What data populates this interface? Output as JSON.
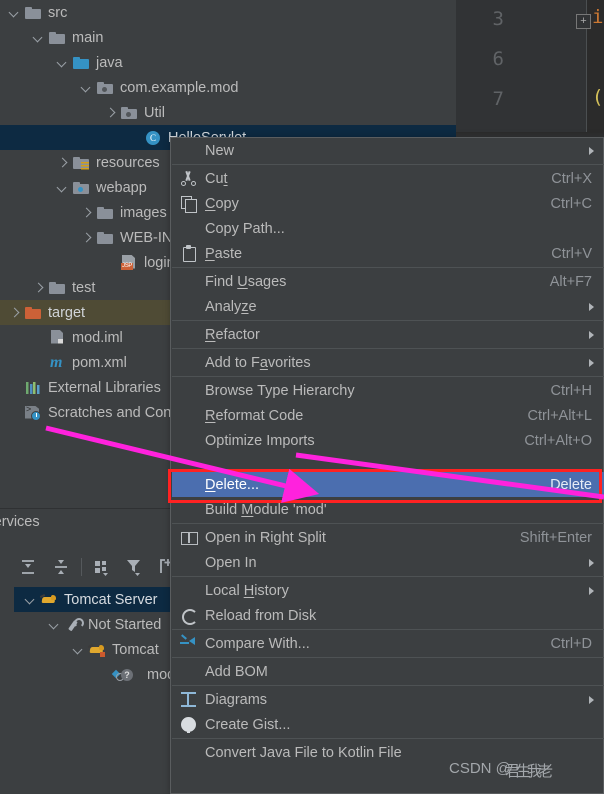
{
  "app": {
    "theme_bg": "#3c3f41",
    "selection_blue": "#0d2a42",
    "menu_highlight": "#4b6eaf",
    "annotation_red": "#ff2222",
    "annotation_magenta": "#ff22dd"
  },
  "editor": {
    "line_numbers": [
      "3",
      "6",
      "7"
    ],
    "fold_marker": "+",
    "code_fragments": [
      "i",
      "("
    ]
  },
  "project_tree": {
    "items": [
      {
        "label": "src",
        "indent": 0,
        "arrow": "down",
        "icon": "folder-icon",
        "selected": "none"
      },
      {
        "label": "main",
        "indent": 1,
        "arrow": "down",
        "icon": "folder-icon",
        "selected": "none"
      },
      {
        "label": "java",
        "indent": 2,
        "arrow": "down",
        "icon": "folder-source-icon",
        "selected": "none"
      },
      {
        "label": "com.example.mod",
        "indent": 3,
        "arrow": "down",
        "icon": "package-icon",
        "selected": "none"
      },
      {
        "label": "Util",
        "indent": 4,
        "arrow": "right",
        "icon": "package-icon",
        "selected": "none"
      },
      {
        "label": "HelloServlet",
        "indent": 5,
        "arrow": "none",
        "icon": "java-class-icon",
        "selected": "primary"
      },
      {
        "label": "resources",
        "indent": 2,
        "arrow": "right",
        "icon": "folder-resources-icon",
        "selected": "none"
      },
      {
        "label": "webapp",
        "indent": 2,
        "arrow": "down",
        "icon": "folder-web-icon",
        "selected": "none"
      },
      {
        "label": "images",
        "indent": 3,
        "arrow": "right",
        "icon": "folder-icon",
        "selected": "none"
      },
      {
        "label": "WEB-INF",
        "indent": 3,
        "arrow": "right",
        "icon": "folder-icon",
        "selected": "none"
      },
      {
        "label": "login.jsp",
        "indent": 4,
        "arrow": "none",
        "icon": "jsp-file-icon",
        "selected": "none"
      },
      {
        "label": "test",
        "indent": 1,
        "arrow": "right",
        "icon": "folder-icon",
        "selected": "none"
      },
      {
        "label": "target",
        "indent": 0,
        "arrow": "right",
        "icon": "folder-excluded-icon",
        "selected": "secondary"
      },
      {
        "label": "mod.iml",
        "indent": 1,
        "arrow": "none",
        "icon": "iml-file-icon",
        "selected": "none"
      },
      {
        "label": "pom.xml",
        "indent": 1,
        "arrow": "none",
        "icon": "maven-file-icon",
        "selected": "none"
      },
      {
        "label": "External Libraries",
        "indent": 0,
        "arrow": "none",
        "icon": "libraries-icon",
        "selected": "none"
      },
      {
        "label": "Scratches and Consoles",
        "indent": 0,
        "arrow": "none",
        "icon": "scratches-icon",
        "selected": "none"
      }
    ]
  },
  "services": {
    "title": "Services",
    "toolbar": [
      {
        "name": "expand-all-icon"
      },
      {
        "name": "collapse-all-icon"
      },
      {
        "name": "group-by-icon"
      },
      {
        "name": "filter-icon"
      },
      {
        "name": "add-service-icon"
      }
    ],
    "tree": [
      {
        "label": "Tomcat Server",
        "indent": 0,
        "arrow": "down",
        "icon": "tomcat-icon",
        "selected": true
      },
      {
        "label": "Not Started",
        "indent": 1,
        "arrow": "down",
        "icon": "wrench-icon",
        "selected": false
      },
      {
        "label": "Tomcat",
        "indent": 2,
        "arrow": "down",
        "icon": "tomcat-run-icon",
        "selected": false
      },
      {
        "label": "mod",
        "indent": 3,
        "arrow": "none",
        "icon": "artifact-icon",
        "selected": false
      }
    ]
  },
  "context_menu": {
    "items": [
      {
        "label": "New",
        "accel": "",
        "icon": "",
        "submenu": true,
        "highlight": false,
        "mnemonic": "",
        "sep_after": true
      },
      {
        "label": "Cut",
        "accel": "Ctrl+X",
        "icon": "cut-icon",
        "submenu": false,
        "highlight": false,
        "mnemonic": "t",
        "sep_after": false
      },
      {
        "label": "Copy",
        "accel": "Ctrl+C",
        "icon": "copy-icon",
        "submenu": false,
        "highlight": false,
        "mnemonic": "C",
        "sep_after": false
      },
      {
        "label": "Copy Path...",
        "accel": "",
        "icon": "",
        "submenu": false,
        "highlight": false,
        "mnemonic": "",
        "sep_after": false
      },
      {
        "label": "Paste",
        "accel": "Ctrl+V",
        "icon": "paste-icon",
        "submenu": false,
        "highlight": false,
        "mnemonic": "P",
        "sep_after": true
      },
      {
        "label": "Find Usages",
        "accel": "Alt+F7",
        "icon": "",
        "submenu": false,
        "highlight": false,
        "mnemonic": "U",
        "sep_after": false
      },
      {
        "label": "Analyze",
        "accel": "",
        "icon": "",
        "submenu": true,
        "highlight": false,
        "mnemonic": "z",
        "sep_after": true
      },
      {
        "label": "Refactor",
        "accel": "",
        "icon": "",
        "submenu": true,
        "highlight": false,
        "mnemonic": "R",
        "sep_after": true
      },
      {
        "label": "Add to Favorites",
        "accel": "",
        "icon": "",
        "submenu": true,
        "highlight": false,
        "mnemonic": "a",
        "sep_after": true
      },
      {
        "label": "Browse Type Hierarchy",
        "accel": "Ctrl+H",
        "icon": "",
        "submenu": false,
        "highlight": false,
        "mnemonic": "",
        "sep_after": false
      },
      {
        "label": "Reformat Code",
        "accel": "Ctrl+Alt+L",
        "icon": "",
        "submenu": false,
        "highlight": false,
        "mnemonic": "R",
        "sep_after": false
      },
      {
        "label": "Optimize Imports",
        "accel": "Ctrl+Alt+O",
        "icon": "",
        "submenu": false,
        "highlight": false,
        "mnemonic": "",
        "sep_after": false
      },
      {
        "label": "Delete...",
        "accel": "Delete",
        "icon": "",
        "submenu": false,
        "highlight": true,
        "mnemonic": "D",
        "sep_after": false
      },
      {
        "label": "Build Module 'mod'",
        "accel": "",
        "icon": "",
        "submenu": false,
        "highlight": false,
        "mnemonic": "M",
        "sep_after": true
      },
      {
        "label": "Open in Right Split",
        "accel": "Shift+Enter",
        "icon": "split-icon",
        "submenu": false,
        "highlight": false,
        "mnemonic": "",
        "sep_after": false
      },
      {
        "label": "Open In",
        "accel": "",
        "icon": "",
        "submenu": true,
        "highlight": false,
        "mnemonic": "",
        "sep_after": true
      },
      {
        "label": "Local History",
        "accel": "",
        "icon": "",
        "submenu": true,
        "highlight": false,
        "mnemonic": "H",
        "sep_after": false
      },
      {
        "label": "Reload from Disk",
        "accel": "",
        "icon": "reload-icon",
        "submenu": false,
        "highlight": false,
        "mnemonic": "",
        "sep_after": true
      },
      {
        "label": "Compare With...",
        "accel": "Ctrl+D",
        "icon": "compare-icon",
        "submenu": false,
        "highlight": false,
        "mnemonic": "",
        "sep_after": true
      },
      {
        "label": "Add BOM",
        "accel": "",
        "icon": "",
        "submenu": false,
        "highlight": false,
        "mnemonic": "",
        "sep_after": true
      },
      {
        "label": "Diagrams",
        "accel": "",
        "icon": "diagram-icon",
        "submenu": true,
        "highlight": false,
        "mnemonic": "",
        "sep_after": false
      },
      {
        "label": "Create Gist...",
        "accel": "",
        "icon": "github-icon",
        "submenu": false,
        "highlight": false,
        "mnemonic": "",
        "sep_after": true
      },
      {
        "label": "Convert Java File to Kotlin File",
        "accel": "",
        "icon": "",
        "submenu": false,
        "highlight": false,
        "mnemonic": "",
        "sep_after": false
      }
    ]
  },
  "watermark": {
    "prefix": "CSDN @",
    "handle": "君生我老"
  }
}
